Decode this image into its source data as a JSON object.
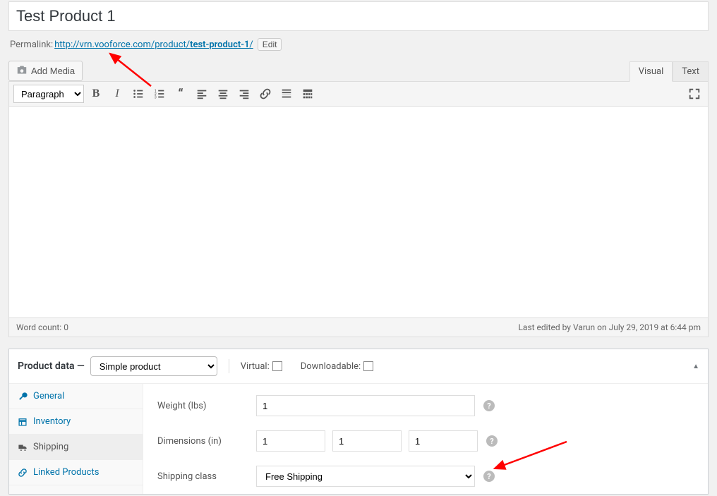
{
  "title": "Test Product 1",
  "permalink": {
    "label": "Permalink:",
    "base": "http://vrn.vooforce.com/product/",
    "slug": "test-product-1",
    "trail": "/",
    "edit": "Edit"
  },
  "media_button": "Add Media",
  "editor_tabs": {
    "visual": "Visual",
    "text": "Text"
  },
  "format_select": "Paragraph",
  "status": {
    "wordcount_label": "Word count: ",
    "wordcount": "0",
    "last_edited": "Last edited by Varun on July 29, 2019 at 6:44 pm"
  },
  "product_data": {
    "title": "Product data —",
    "type": "Simple product",
    "virtual": "Virtual:",
    "downloadable": "Downloadable:"
  },
  "tabs": {
    "general": "General",
    "inventory": "Inventory",
    "shipping": "Shipping",
    "linked": "Linked Products"
  },
  "fields": {
    "weight_label": "Weight (lbs)",
    "weight_value": "1",
    "dimensions_label": "Dimensions (in)",
    "dim_l": "1",
    "dim_w": "1",
    "dim_h": "1",
    "shipping_class_label": "Shipping class",
    "shipping_class_value": "Free Shipping"
  },
  "help": "?"
}
